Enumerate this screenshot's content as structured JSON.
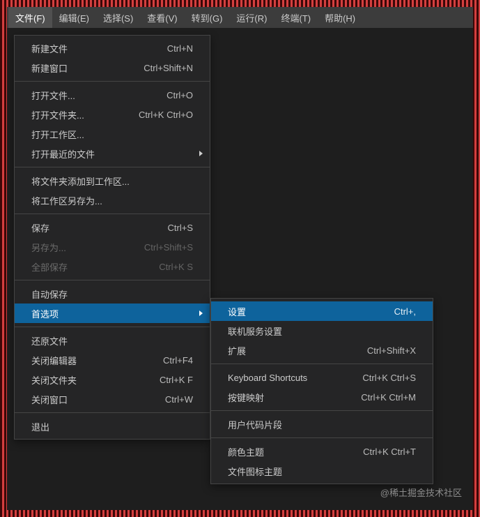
{
  "menubar": {
    "items": [
      {
        "label": "文件(F)",
        "active": true
      },
      {
        "label": "编辑(E)"
      },
      {
        "label": "选择(S)"
      },
      {
        "label": "查看(V)"
      },
      {
        "label": "转到(G)"
      },
      {
        "label": "运行(R)"
      },
      {
        "label": "终端(T)"
      },
      {
        "label": "帮助(H)"
      }
    ]
  },
  "fileMenu": {
    "groups": [
      [
        {
          "label": "新建文件",
          "shortcut": "Ctrl+N"
        },
        {
          "label": "新建窗口",
          "shortcut": "Ctrl+Shift+N"
        }
      ],
      [
        {
          "label": "打开文件...",
          "shortcut": "Ctrl+O"
        },
        {
          "label": "打开文件夹...",
          "shortcut": "Ctrl+K Ctrl+O"
        },
        {
          "label": "打开工作区..."
        },
        {
          "label": "打开最近的文件",
          "submenu": true
        }
      ],
      [
        {
          "label": "将文件夹添加到工作区..."
        },
        {
          "label": "将工作区另存为..."
        }
      ],
      [
        {
          "label": "保存",
          "shortcut": "Ctrl+S"
        },
        {
          "label": "另存为...",
          "shortcut": "Ctrl+Shift+S",
          "disabled": true
        },
        {
          "label": "全部保存",
          "shortcut": "Ctrl+K S",
          "disabled": true
        }
      ],
      [
        {
          "label": "自动保存"
        },
        {
          "label": "首选项",
          "submenu": true,
          "highlight": true
        }
      ],
      [
        {
          "label": "还原文件"
        },
        {
          "label": "关闭编辑器",
          "shortcut": "Ctrl+F4"
        },
        {
          "label": "关闭文件夹",
          "shortcut": "Ctrl+K F"
        },
        {
          "label": "关闭窗口",
          "shortcut": "Ctrl+W"
        }
      ],
      [
        {
          "label": "退出"
        }
      ]
    ]
  },
  "prefsMenu": {
    "groups": [
      [
        {
          "label": "设置",
          "shortcut": "Ctrl+,",
          "highlight": true
        },
        {
          "label": "联机服务设置"
        },
        {
          "label": "扩展",
          "shortcut": "Ctrl+Shift+X"
        }
      ],
      [
        {
          "label": "Keyboard Shortcuts",
          "shortcut": "Ctrl+K Ctrl+S"
        },
        {
          "label": "按键映射",
          "shortcut": "Ctrl+K Ctrl+M"
        }
      ],
      [
        {
          "label": "用户代码片段"
        }
      ],
      [
        {
          "label": "颜色主题",
          "shortcut": "Ctrl+K Ctrl+T"
        },
        {
          "label": "文件图标主题"
        }
      ]
    ]
  },
  "watermark": "@稀土掘金技术社区"
}
